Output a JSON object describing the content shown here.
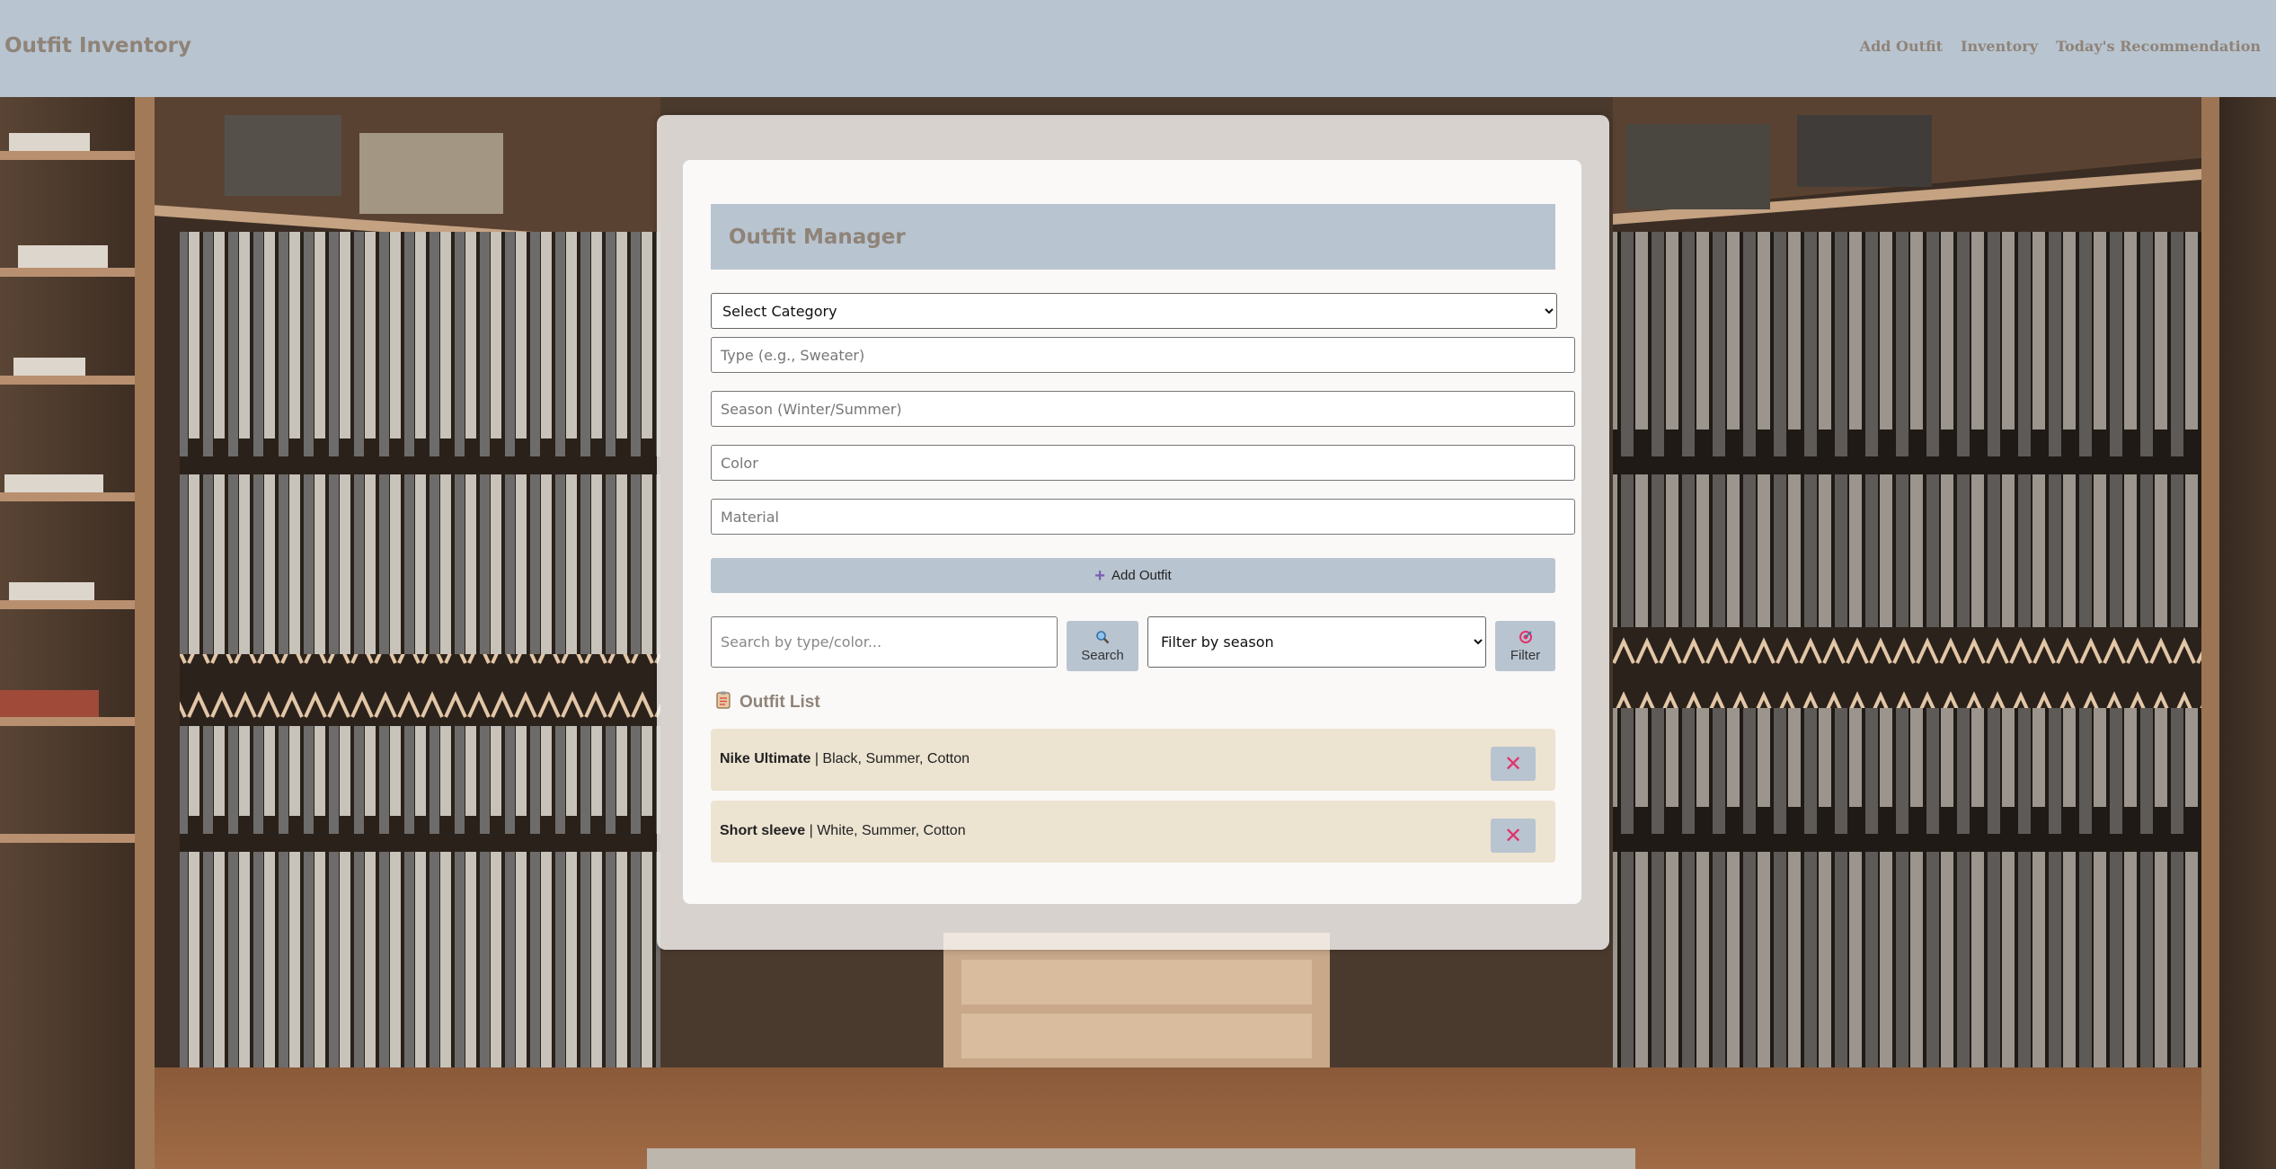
{
  "navbar": {
    "brand": "Outfit Inventory",
    "links": [
      "Add Outfit",
      "Inventory",
      "Today's Recommendation"
    ]
  },
  "manager": {
    "title": "Outfit Manager",
    "category_select": "Select Category",
    "type_placeholder": "Type (e.g., Sweater)",
    "season_placeholder": "Season (Winter/Summer)",
    "color_placeholder": "Color",
    "material_placeholder": "Material",
    "add_button": "Add Outfit"
  },
  "search": {
    "placeholder": "Search by type/color...",
    "search_button": "Search",
    "season_filter": "Filter by season",
    "filter_button": "Filter"
  },
  "list": {
    "heading": "Outfit List",
    "items": [
      {
        "name": "Nike Ultimate",
        "details": " | Black, Summer, Cotton"
      },
      {
        "name": "Short sleeve",
        "details": " | White, Summer, Cotton"
      }
    ]
  },
  "icons": {
    "add": "plus-icon",
    "search": "magnifier-icon",
    "filter": "target-icon",
    "list": "clipboard-icon",
    "delete": "close-icon"
  },
  "colors": {
    "accent": "#b8c4d0",
    "brand_text": "#8f8378",
    "list_item_bg": "#ece3d1",
    "delete_icon": "#e0336a"
  }
}
